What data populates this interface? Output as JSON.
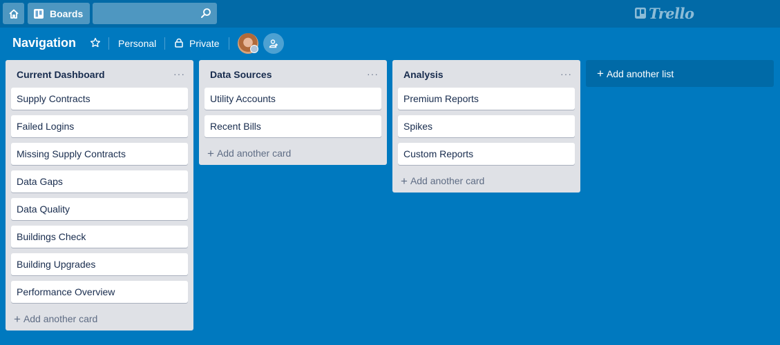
{
  "topbar": {
    "boards_label": "Boards",
    "search_value": "",
    "logo_text": "Trello"
  },
  "board": {
    "title": "Navigation",
    "team": "Personal",
    "privacy": "Private"
  },
  "lists": [
    {
      "title": "Current Dashboard",
      "menu": "···",
      "cards": [
        "Supply Contracts",
        "Failed Logins",
        "Missing Supply Contracts",
        "Data Gaps",
        "Data Quality",
        "Buildings Check",
        "Building Upgrades",
        "Performance Overview"
      ],
      "add_card_label": "Add another card"
    },
    {
      "title": "Data Sources",
      "menu": "···",
      "cards": [
        "Utility Accounts",
        "Recent Bills"
      ],
      "add_card_label": "Add another card"
    },
    {
      "title": "Analysis",
      "menu": "···",
      "cards": [
        "Premium Reports",
        "Spikes",
        "Custom Reports"
      ],
      "add_card_label": "Add another card"
    }
  ],
  "add_list_label": "Add another list",
  "colors": {
    "board_background": "#0079bf",
    "topbar": "#026aa7",
    "list_background": "#dfe1e6"
  }
}
